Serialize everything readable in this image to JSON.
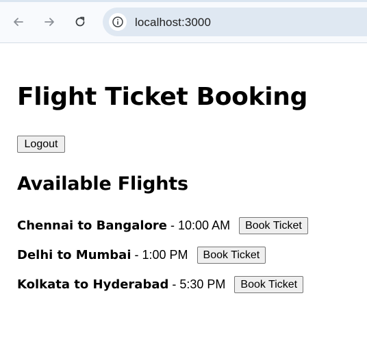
{
  "browser": {
    "url": "localhost:3000",
    "icons": {
      "back": "arrow-left-icon",
      "forward": "arrow-right-icon",
      "reload": "reload-icon",
      "site_info": "info-icon"
    }
  },
  "page": {
    "title": "Flight Ticket Booking",
    "logout_label": "Logout",
    "section_title": "Available Flights",
    "flights": [
      {
        "route": "Chennai to Bangalore",
        "separator": " - ",
        "time": "10:00 AM",
        "action": "Book Ticket"
      },
      {
        "route": "Delhi to Mumbai",
        "separator": " - ",
        "time": "1:00 PM",
        "action": "Book Ticket"
      },
      {
        "route": "Kolkata to Hyderabad",
        "separator": " - ",
        "time": "5:30 PM",
        "action": "Book Ticket"
      }
    ]
  }
}
